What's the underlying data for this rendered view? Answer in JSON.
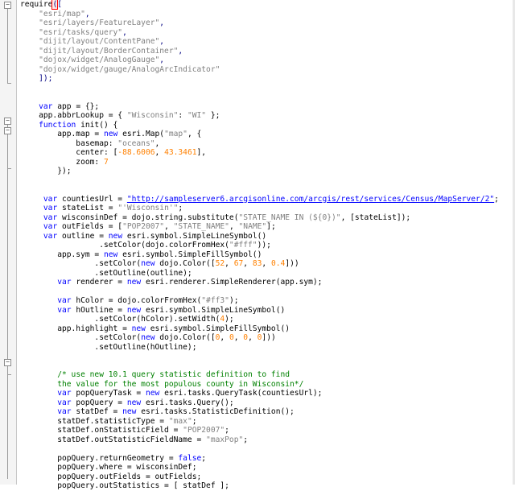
{
  "editor": {
    "lines": [
      [
        {
          "t": "require",
          "c": ""
        },
        {
          "t": "(",
          "c": "op"
        },
        {
          "t": "[",
          "c": "op"
        }
      ],
      [
        {
          "t": "    ",
          "c": ""
        },
        {
          "t": "\"esri/map\"",
          "c": "str"
        },
        {
          "t": ",",
          "c": "op"
        }
      ],
      [
        {
          "t": "    ",
          "c": ""
        },
        {
          "t": "\"esri/layers/FeatureLayer\"",
          "c": "str"
        },
        {
          "t": ",",
          "c": "op"
        }
      ],
      [
        {
          "t": "    ",
          "c": ""
        },
        {
          "t": "\"esri/tasks/query\"",
          "c": "str"
        },
        {
          "t": ",",
          "c": "op"
        }
      ],
      [
        {
          "t": "    ",
          "c": ""
        },
        {
          "t": "\"dijit/layout/ContentPane\"",
          "c": "str"
        },
        {
          "t": ",",
          "c": "op"
        }
      ],
      [
        {
          "t": "    ",
          "c": ""
        },
        {
          "t": "\"dijit/layout/BorderContainer\"",
          "c": "str"
        },
        {
          "t": ",",
          "c": "op"
        }
      ],
      [
        {
          "t": "    ",
          "c": ""
        },
        {
          "t": "\"dojox/widget/AnalogGauge\"",
          "c": "str"
        },
        {
          "t": ",",
          "c": "op"
        }
      ],
      [
        {
          "t": "    ",
          "c": ""
        },
        {
          "t": "\"dojox/widget/gauge/AnalogArcIndicator\"",
          "c": "str"
        }
      ],
      [
        {
          "t": "    ",
          "c": ""
        },
        {
          "t": "]);",
          "c": "op"
        }
      ],
      [],
      [],
      [
        {
          "t": "    ",
          "c": ""
        },
        {
          "t": "var",
          "c": "kw"
        },
        {
          "t": " app = {};",
          "c": ""
        }
      ],
      [
        {
          "t": "    app.abbrLookup = { ",
          "c": ""
        },
        {
          "t": "\"Wisconsin\"",
          "c": "str"
        },
        {
          "t": ": ",
          "c": ""
        },
        {
          "t": "\"WI\"",
          "c": "str"
        },
        {
          "t": " };",
          "c": ""
        }
      ],
      [
        {
          "t": "    ",
          "c": ""
        },
        {
          "t": "function",
          "c": "kw"
        },
        {
          "t": " init() {",
          "c": ""
        }
      ],
      [
        {
          "t": "        app.map = ",
          "c": ""
        },
        {
          "t": "new",
          "c": "kw"
        },
        {
          "t": " esri.Map(",
          "c": ""
        },
        {
          "t": "\"map\"",
          "c": "str"
        },
        {
          "t": ", {",
          "c": ""
        }
      ],
      [
        {
          "t": "            basemap: ",
          "c": ""
        },
        {
          "t": "\"oceans\"",
          "c": "str"
        },
        {
          "t": ",",
          "c": ""
        }
      ],
      [
        {
          "t": "            center: [",
          "c": ""
        },
        {
          "t": "-88.6006",
          "c": "num"
        },
        {
          "t": ", ",
          "c": ""
        },
        {
          "t": "43.3461",
          "c": "num"
        },
        {
          "t": "],",
          "c": ""
        }
      ],
      [
        {
          "t": "            zoom: ",
          "c": ""
        },
        {
          "t": "7",
          "c": "num"
        }
      ],
      [
        {
          "t": "        });",
          "c": ""
        }
      ],
      [],
      [],
      [
        {
          "t": "     ",
          "c": ""
        },
        {
          "t": "var",
          "c": "kw"
        },
        {
          "t": " countiesUrl = ",
          "c": ""
        },
        {
          "t": "\"http://sampleserver6.arcgisonline.com/arcgis/rest/services/Census/MapServer/2\"",
          "c": "url"
        },
        {
          "t": ";",
          "c": ""
        }
      ],
      [
        {
          "t": "     ",
          "c": ""
        },
        {
          "t": "var",
          "c": "kw"
        },
        {
          "t": " stateList = ",
          "c": ""
        },
        {
          "t": "\"'Wisconsin'\"",
          "c": "str"
        },
        {
          "t": ";",
          "c": ""
        }
      ],
      [
        {
          "t": "     ",
          "c": ""
        },
        {
          "t": "var",
          "c": "kw"
        },
        {
          "t": " wisconsinDef = dojo.string.substitute(",
          "c": ""
        },
        {
          "t": "\"STATE_NAME IN (${0})\"",
          "c": "str"
        },
        {
          "t": ", [stateList]);",
          "c": ""
        }
      ],
      [
        {
          "t": "     ",
          "c": ""
        },
        {
          "t": "var",
          "c": "kw"
        },
        {
          "t": " outFields = [",
          "c": ""
        },
        {
          "t": "\"POP2007\"",
          "c": "str"
        },
        {
          "t": ", ",
          "c": ""
        },
        {
          "t": "\"STATE_NAME\"",
          "c": "str"
        },
        {
          "t": ", ",
          "c": ""
        },
        {
          "t": "\"NAME\"",
          "c": "str"
        },
        {
          "t": "];",
          "c": ""
        }
      ],
      [
        {
          "t": "     ",
          "c": ""
        },
        {
          "t": "var",
          "c": "kw"
        },
        {
          "t": " outline = ",
          "c": ""
        },
        {
          "t": "new",
          "c": "kw"
        },
        {
          "t": " esri.symbol.SimpleLineSymbol()",
          "c": ""
        }
      ],
      [
        {
          "t": "                 .setColor(dojo.colorFromHex(",
          "c": ""
        },
        {
          "t": "\"#fff\"",
          "c": "str"
        },
        {
          "t": "));",
          "c": ""
        }
      ],
      [
        {
          "t": "        app.sym = ",
          "c": ""
        },
        {
          "t": "new",
          "c": "kw"
        },
        {
          "t": " esri.symbol.SimpleFillSymbol()",
          "c": ""
        }
      ],
      [
        {
          "t": "                .setColor(",
          "c": ""
        },
        {
          "t": "new",
          "c": "kw"
        },
        {
          "t": " dojo.Color([",
          "c": ""
        },
        {
          "t": "52",
          "c": "num"
        },
        {
          "t": ", ",
          "c": ""
        },
        {
          "t": "67",
          "c": "num"
        },
        {
          "t": ", ",
          "c": ""
        },
        {
          "t": "83",
          "c": "num"
        },
        {
          "t": ", ",
          "c": ""
        },
        {
          "t": "0.4",
          "c": "num"
        },
        {
          "t": "]))",
          "c": ""
        }
      ],
      [
        {
          "t": "                .setOutline(outline);",
          "c": ""
        }
      ],
      [
        {
          "t": "        ",
          "c": ""
        },
        {
          "t": "var",
          "c": "kw"
        },
        {
          "t": " renderer = ",
          "c": ""
        },
        {
          "t": "new",
          "c": "kw"
        },
        {
          "t": " esri.renderer.SimpleRenderer(app.sym);",
          "c": ""
        }
      ],
      [],
      [
        {
          "t": "        ",
          "c": ""
        },
        {
          "t": "var",
          "c": "kw"
        },
        {
          "t": " hColor = dojo.colorFromHex(",
          "c": ""
        },
        {
          "t": "\"#ff3\"",
          "c": "str"
        },
        {
          "t": ");",
          "c": ""
        }
      ],
      [
        {
          "t": "        ",
          "c": ""
        },
        {
          "t": "var",
          "c": "kw"
        },
        {
          "t": " hOutline = ",
          "c": ""
        },
        {
          "t": "new",
          "c": "kw"
        },
        {
          "t": " esri.symbol.SimpleLineSymbol()",
          "c": ""
        }
      ],
      [
        {
          "t": "                .setColor(hColor).setWidth(",
          "c": ""
        },
        {
          "t": "4",
          "c": "num"
        },
        {
          "t": ");",
          "c": ""
        }
      ],
      [
        {
          "t": "        app.highlight = ",
          "c": ""
        },
        {
          "t": "new",
          "c": "kw"
        },
        {
          "t": " esri.symbol.SimpleFillSymbol()",
          "c": ""
        }
      ],
      [
        {
          "t": "                .setColor(",
          "c": ""
        },
        {
          "t": "new",
          "c": "kw"
        },
        {
          "t": " dojo.Color([",
          "c": ""
        },
        {
          "t": "0",
          "c": "num"
        },
        {
          "t": ", ",
          "c": ""
        },
        {
          "t": "0",
          "c": "num"
        },
        {
          "t": ", ",
          "c": ""
        },
        {
          "t": "0",
          "c": "num"
        },
        {
          "t": ", ",
          "c": ""
        },
        {
          "t": "0",
          "c": "num"
        },
        {
          "t": "]))",
          "c": ""
        }
      ],
      [
        {
          "t": "                .setOutline(hOutline);",
          "c": ""
        }
      ],
      [],
      [],
      [
        {
          "t": "        ",
          "c": ""
        },
        {
          "t": "/* use new 10.1 query statistic definition to find",
          "c": "cmt"
        }
      ],
      [
        {
          "t": "        ",
          "c": ""
        },
        {
          "t": "the value for the most populous county in Wisconsin*/",
          "c": "cmt"
        }
      ],
      [
        {
          "t": "        ",
          "c": ""
        },
        {
          "t": "var",
          "c": "kw"
        },
        {
          "t": " popQueryTask = ",
          "c": ""
        },
        {
          "t": "new",
          "c": "kw"
        },
        {
          "t": " esri.tasks.QueryTask(countiesUrl);",
          "c": ""
        }
      ],
      [
        {
          "t": "        ",
          "c": ""
        },
        {
          "t": "var",
          "c": "kw"
        },
        {
          "t": " popQuery = ",
          "c": ""
        },
        {
          "t": "new",
          "c": "kw"
        },
        {
          "t": " esri.tasks.Query();",
          "c": ""
        }
      ],
      [
        {
          "t": "        ",
          "c": ""
        },
        {
          "t": "var",
          "c": "kw"
        },
        {
          "t": " statDef = ",
          "c": ""
        },
        {
          "t": "new",
          "c": "kw"
        },
        {
          "t": " esri.tasks.StatisticDefinition();",
          "c": ""
        }
      ],
      [
        {
          "t": "        statDef.statisticType = ",
          "c": ""
        },
        {
          "t": "\"max\"",
          "c": "str"
        },
        {
          "t": ";",
          "c": ""
        }
      ],
      [
        {
          "t": "        statDef.onStatisticField = ",
          "c": ""
        },
        {
          "t": "\"POP2007\"",
          "c": "str"
        },
        {
          "t": ";",
          "c": ""
        }
      ],
      [
        {
          "t": "        statDef.outStatisticFieldName = ",
          "c": ""
        },
        {
          "t": "\"maxPop\"",
          "c": "str"
        },
        {
          "t": ";",
          "c": ""
        }
      ],
      [],
      [
        {
          "t": "        popQuery.returnGeometry = ",
          "c": ""
        },
        {
          "t": "false",
          "c": "kw"
        },
        {
          "t": ";",
          "c": ""
        }
      ],
      [
        {
          "t": "        popQuery.where = wisconsinDef;",
          "c": ""
        }
      ],
      [
        {
          "t": "        popQuery.outFields = outFields;",
          "c": ""
        }
      ],
      [
        {
          "t": "        popQuery.outStatistics = [ statDef ];",
          "c": ""
        }
      ]
    ],
    "colors": {
      "keyword": "#0000ff",
      "string": "#808080",
      "number": "#ff8000",
      "comment": "#008000",
      "fold_markers": [
        "minus-box-icon",
        "minus-box-icon",
        "minus-box-icon",
        "minus-box-icon"
      ]
    }
  }
}
